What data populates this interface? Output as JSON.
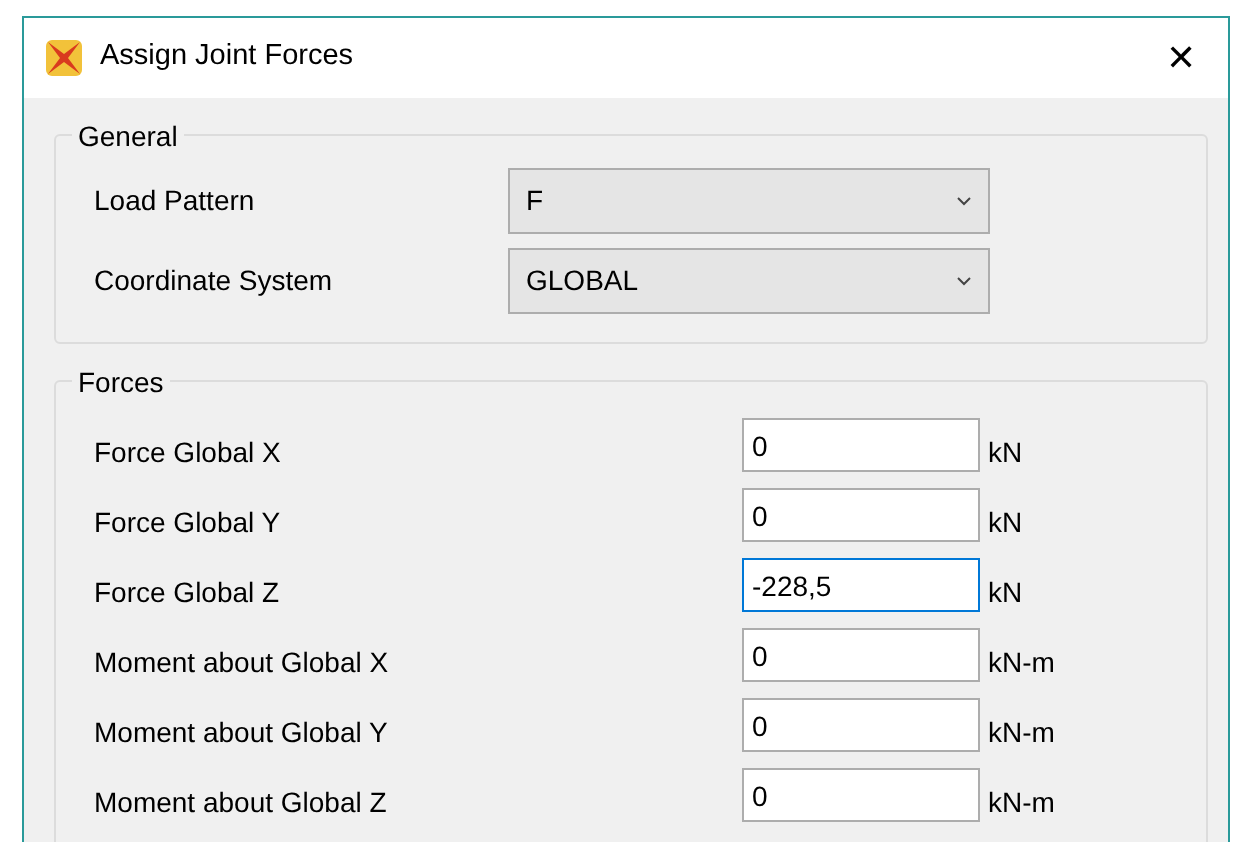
{
  "window": {
    "title": "Assign Joint Forces",
    "close": "✕"
  },
  "general": {
    "title": "General",
    "fields": [
      {
        "label": "Load Pattern",
        "value": "F"
      },
      {
        "label": "Coordinate System",
        "value": "GLOBAL"
      }
    ]
  },
  "forces": {
    "title": "Forces",
    "fields": [
      {
        "label": "Force Global X",
        "value": "0",
        "unit": "kN",
        "focused": false
      },
      {
        "label": "Force Global Y",
        "value": "0",
        "unit": "kN",
        "focused": false
      },
      {
        "label": "Force Global Z",
        "value": "-228,5",
        "unit": "kN",
        "focused": true
      },
      {
        "label": "Moment about Global X",
        "value": "0",
        "unit": "kN-m",
        "focused": false
      },
      {
        "label": "Moment about Global Y",
        "value": "0",
        "unit": "kN-m",
        "focused": false
      },
      {
        "label": "Moment about Global Z",
        "value": "0",
        "unit": "kN-m",
        "focused": false
      }
    ]
  }
}
